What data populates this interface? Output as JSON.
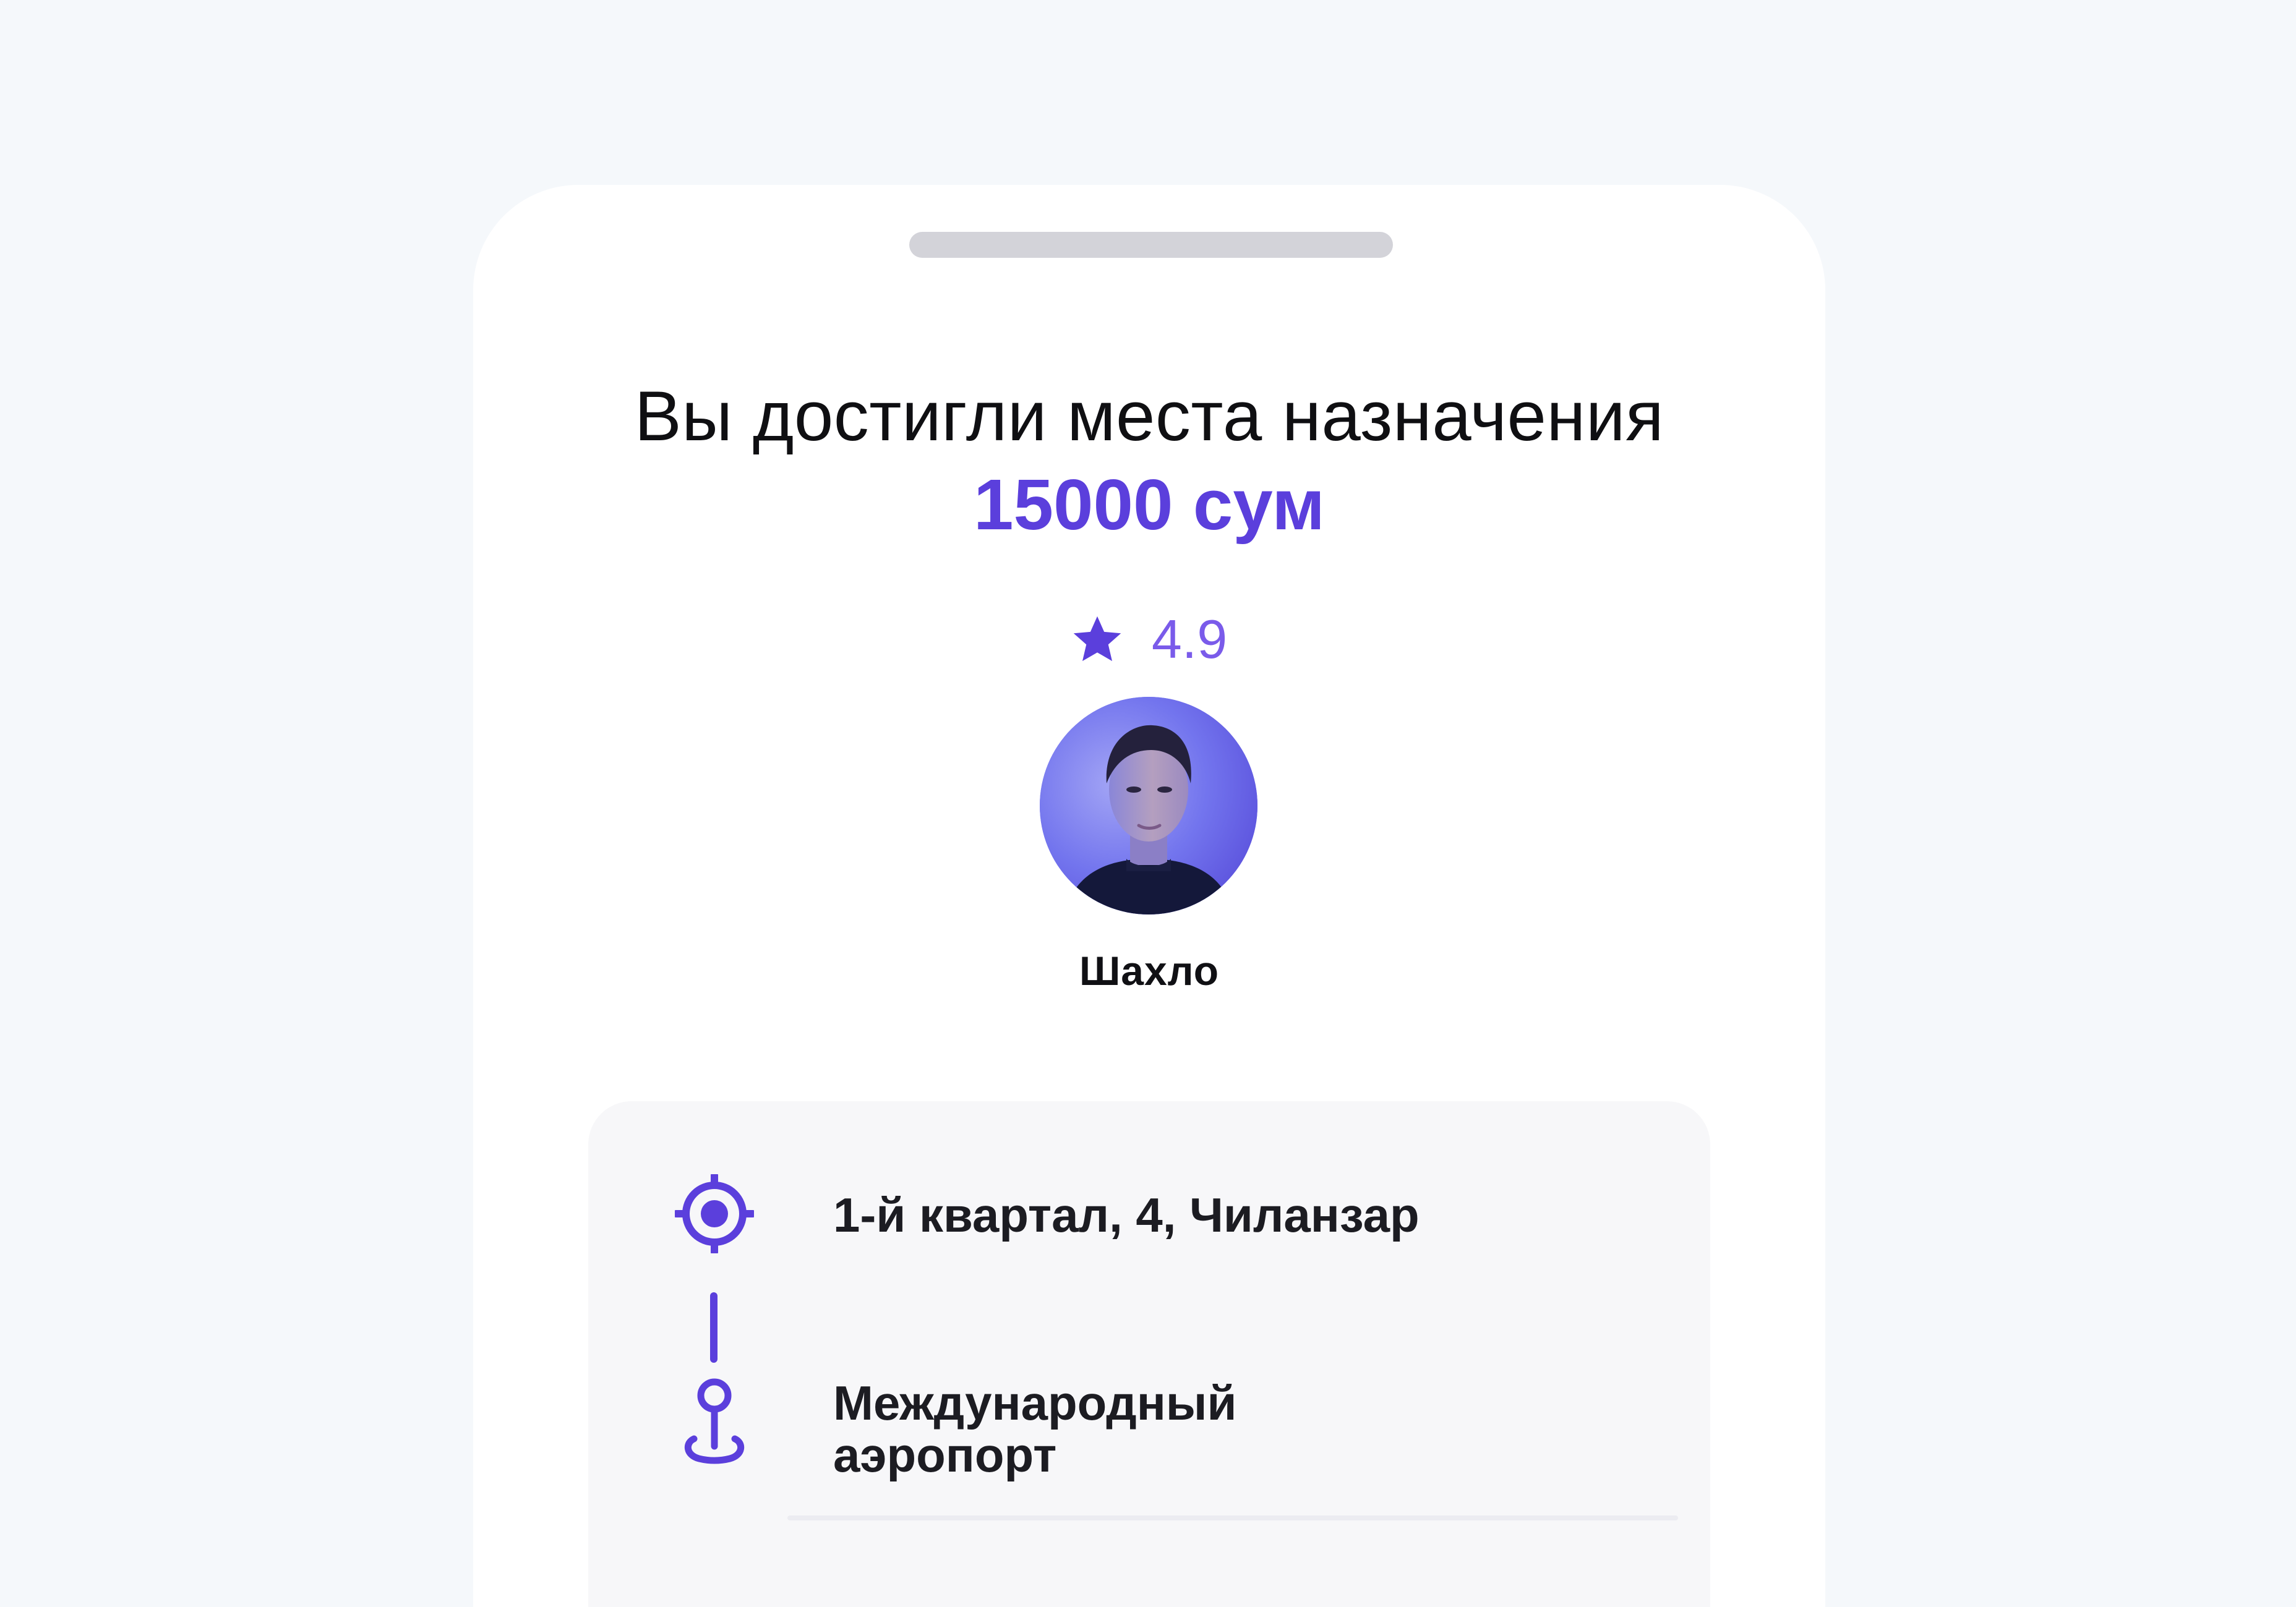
{
  "trip": {
    "title": "Вы достигли места назначения",
    "price": "15000 сум"
  },
  "driver": {
    "rating": "4.9",
    "name": "Шахло"
  },
  "route": {
    "from": "1-й квартал, 4, Чиланзар",
    "to_line1": "Международный",
    "to_line2": "аэропорт"
  },
  "colors": {
    "accent": "#5b3fdc",
    "rating": "#7a5bea",
    "background": "#f5f8fb",
    "card": "#f7f7f9",
    "grabber": "#d3d3d9"
  },
  "icons": {
    "rating": "star-icon",
    "pickup": "pickup-target-icon",
    "destination": "destination-pin-icon"
  }
}
